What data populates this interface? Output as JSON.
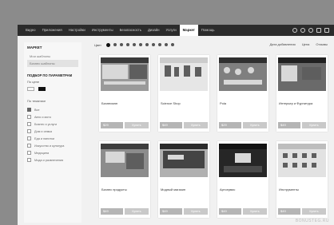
{
  "topnav": [
    {
      "label": "Видео"
    },
    {
      "label": "Приложения"
    },
    {
      "label": "Настройки"
    },
    {
      "label": "Инструменты"
    },
    {
      "label": "Безопасность"
    },
    {
      "label": "Дизайн"
    },
    {
      "label": "Услуги"
    },
    {
      "label": "Маркет",
      "active": true
    },
    {
      "label": "Помощь"
    }
  ],
  "sidebar": {
    "title": "МАРКЕТ",
    "links": [
      {
        "label": "Мои шаблоны"
      },
      {
        "label": "Бизнес шаблоны",
        "active": true
      }
    ],
    "filter_heading": "ПОДБОР ПО ПАРАМЕТРАМ",
    "price_label": "По цене",
    "topics_label": "По тематике",
    "filters": [
      {
        "label": "Все",
        "checked": true
      },
      {
        "label": "Авто и мото"
      },
      {
        "label": "Бизнес и услуги"
      },
      {
        "label": "Дом и семья"
      },
      {
        "label": "Еда и напитки"
      },
      {
        "label": "Искусство и культура"
      },
      {
        "label": "Медицина"
      },
      {
        "label": "Мода и развлечения"
      }
    ]
  },
  "toolbar": {
    "label": "Цвет",
    "sort_date": "Дата добавления",
    "sort_price": "Цена",
    "sort_reviews": "Отзывы"
  },
  "cards": [
    {
      "name": "Бизнесмэн",
      "price": "$29",
      "buy": "Купить"
    },
    {
      "name": "Science Shop",
      "price": "$49",
      "buy": "Купить"
    },
    {
      "name": "Pola",
      "price": "$29",
      "buy": "Купить"
    },
    {
      "name": "Интерьер и Фурнитура",
      "price": "$49",
      "buy": "Купить"
    },
    {
      "name": "Бизнес продукты",
      "price": "$49",
      "buy": "Купить"
    },
    {
      "name": "Модный магазин",
      "price": "$49",
      "buy": "Купить"
    },
    {
      "name": "Артсервис",
      "price": "$49",
      "buy": "Купить"
    },
    {
      "name": "Инструменты",
      "price": "$49",
      "buy": "Купить"
    }
  ],
  "watermark": "BONUSTEG.RU"
}
